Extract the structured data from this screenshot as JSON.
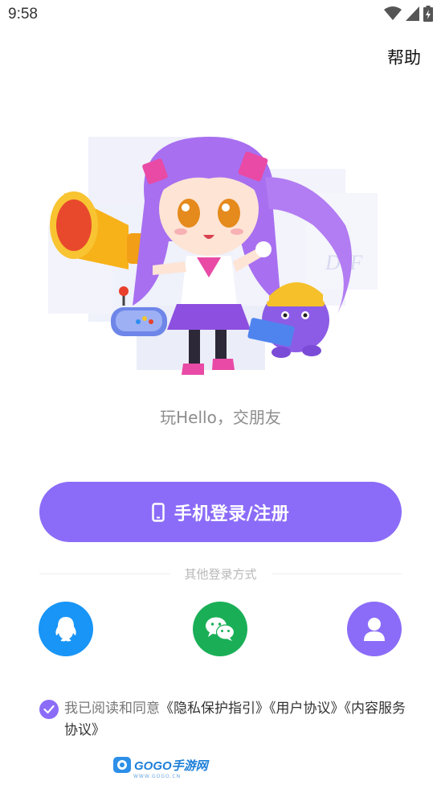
{
  "status_bar": {
    "time": "9:58",
    "icons": [
      "wifi-icon",
      "cell-signal-icon",
      "battery-charging-icon"
    ]
  },
  "header": {
    "help_label": "帮助"
  },
  "hero": {
    "illustration": "mascot-girl-megaphone-with-purple-pet"
  },
  "slogan": "玩Hello，交朋友",
  "primary_action": {
    "label": "手机登录/注册",
    "icon": "phone-icon",
    "color": "#8b6cf8"
  },
  "other_login": {
    "label": "其他登录方式",
    "options": [
      {
        "id": "qq",
        "icon": "qq-penguin-icon",
        "color": "#1895f6"
      },
      {
        "id": "wechat",
        "icon": "wechat-icon",
        "color": "#1aaf57"
      },
      {
        "id": "guest",
        "icon": "person-icon",
        "color": "#8b6cf8"
      }
    ]
  },
  "agreement": {
    "checked": true,
    "prefix": "我已阅读和同意",
    "links": [
      "《隐私保护指引》",
      "《用户协议》",
      "《内容服务协议》"
    ]
  },
  "watermark": {
    "brand": "GOGO手游网",
    "url": "WWW.GOGO.CN"
  }
}
